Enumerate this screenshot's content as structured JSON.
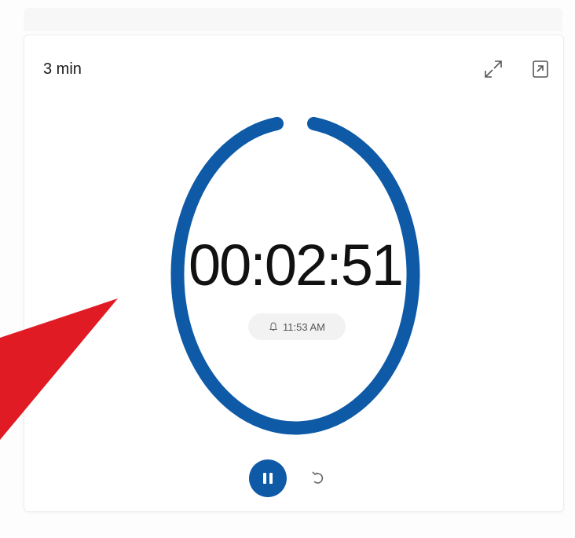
{
  "timer": {
    "name": "3 min",
    "remaining": "00:02:51",
    "end_time": "11:53 AM",
    "progress_fraction": 0.95
  },
  "icons": {
    "expand": "expand-icon",
    "keep_on_top": "keep-on-top-icon",
    "alarm": "bell-icon",
    "pause": "pause-icon",
    "reset": "reset-icon"
  },
  "colors": {
    "ring": "#0e5aa7",
    "pause_button": "#0e5aa7",
    "arrow": "#e01b24"
  }
}
